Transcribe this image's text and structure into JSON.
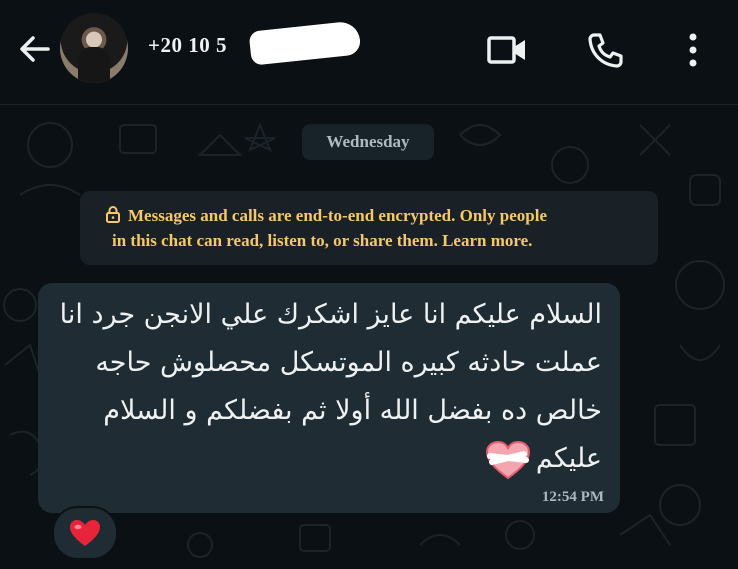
{
  "header": {
    "contact_name": "+20 10 5",
    "icons": {
      "back": "arrow-left-icon",
      "video": "video-camera-icon",
      "call": "phone-icon",
      "menu": "more-vertical-icon"
    }
  },
  "chat": {
    "date_label": "Wednesday",
    "encryption_notice_line1": "Messages and calls are end-to-end encrypted. Only people",
    "encryption_notice_line2": "in this chat can read, listen to, or share them. Learn more.",
    "message": {
      "text": "السلام عليكم انا عايز اشكرك علي الانجن جرد انا عملت حادثه كبيره الموتسكل محصلوش حاجه خالص ده بفضل الله أولا ثم بفضلكم و السلام عليكم",
      "time": "12:54 PM",
      "emoji": "heart-with-bandage",
      "reaction": "red-heart"
    }
  },
  "colors": {
    "background": "#0b1014",
    "bubble": "#1f2c33",
    "notice_text": "#f6c86b",
    "chip": "#182229"
  }
}
